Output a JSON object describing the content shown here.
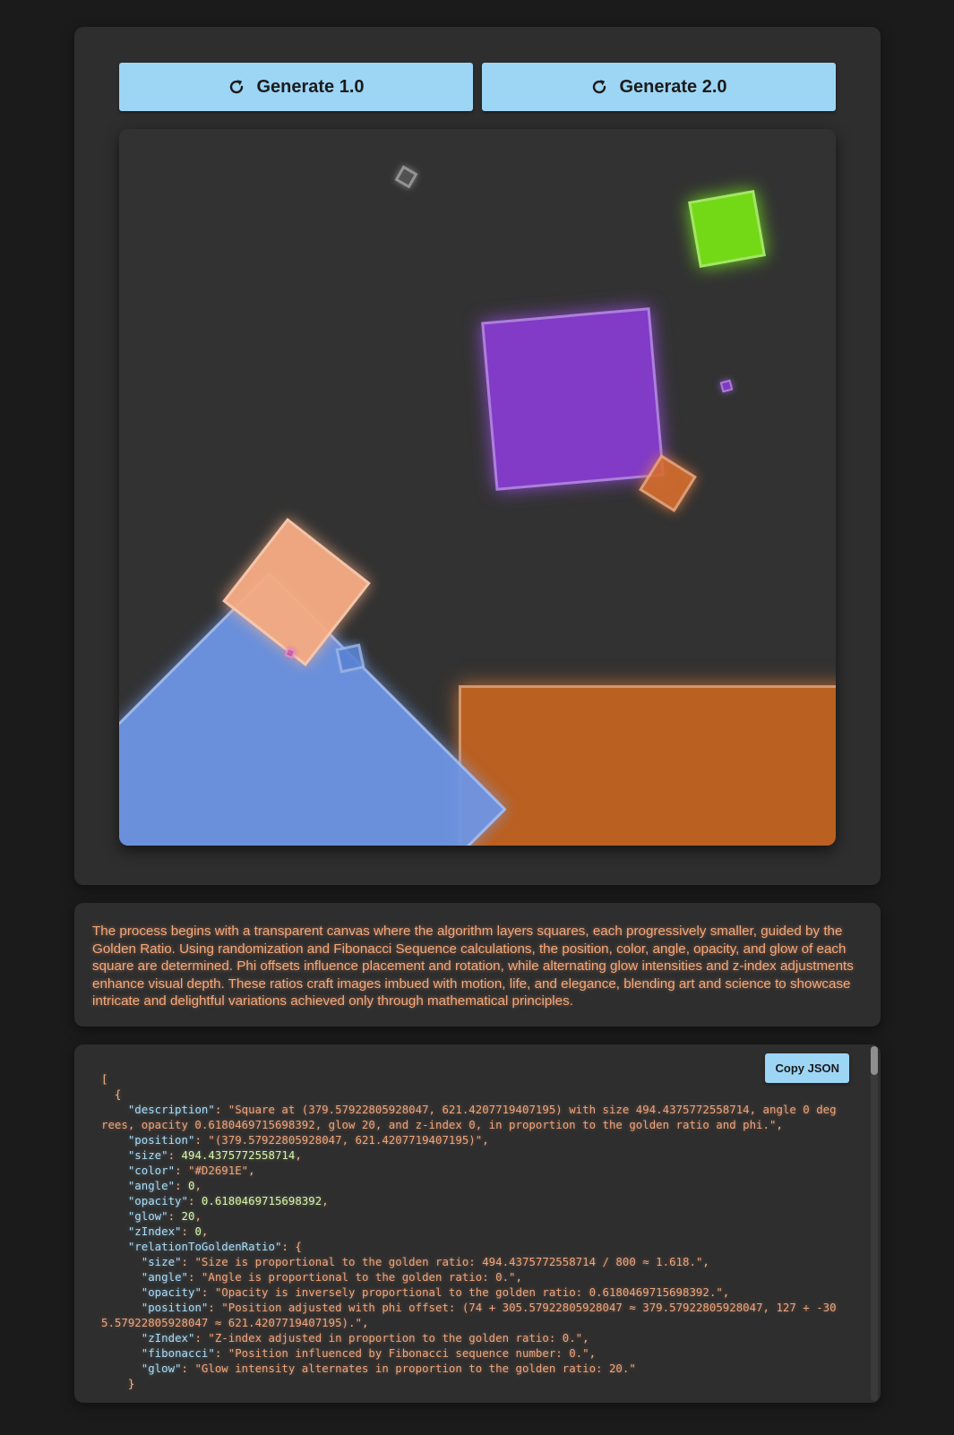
{
  "buttons": {
    "generate_1": "Generate 1.0",
    "generate_2": "Generate 2.0",
    "copy_json": "Copy JSON"
  },
  "icons": {
    "generate": "refresh-icon"
  },
  "colors": {
    "button_bg": "#9dd5f5",
    "text_accent": "#f7a778",
    "json_key": "#a8dcf8",
    "json_number": "#d7f3a8",
    "canvas_bg": "#323232",
    "page_bg": "#1b1b1b"
  },
  "description": "The process begins with a transparent canvas where the algorithm layers squares, each progressively smaller, guided by the Golden Ratio. Using randomization and Fibonacci Sequence calculations, the position, color, angle, opacity, and glow of each square are determined. Phi offsets influence placement and rotation, while alternating glow intensities and z-index adjustments enhance visual depth. These ratios craft images imbued with motion, life, and elegance, blending art and science to showcase intricate and delightful variations achieved only through mathematical principles.",
  "json_lines": {
    "open_bracket": "[",
    "open_brace": "{",
    "k_description": "\"description\"",
    "v_description": "\"Square at (379.57922805928047, 621.4207719407195) with size 494.4375772558714, angle 0 degrees, opacity 0.6180469715698392, glow 20, and z-index 0, in proportion to the golden ratio and phi.\"",
    "k_position": "\"position\"",
    "v_position": "\"(379.57922805928047, 621.4207719407195)\"",
    "k_size": "\"size\"",
    "v_size": "494.4375772558714",
    "k_color": "\"color\"",
    "v_color": "\"#D2691E\"",
    "k_angle": "\"angle\"",
    "v_angle": "0",
    "k_opacity": "\"opacity\"",
    "v_opacity": "0.6180469715698392",
    "k_glow": "\"glow\"",
    "v_glow": "20",
    "k_zindex": "\"zIndex\"",
    "v_zindex": "0",
    "k_relation": "\"relationToGoldenRatio\"",
    "r_k_size": "\"size\"",
    "r_v_size": "\"Size is proportional to the golden ratio: 494.4375772558714 / 800 ≈ 1.618.\"",
    "r_k_angle": "\"angle\"",
    "r_v_angle": "\"Angle is proportional to the golden ratio: 0.\"",
    "r_k_opacity": "\"opacity\"",
    "r_v_opacity": "\"Opacity is inversely proportional to the golden ratio: 0.6180469715698392.\"",
    "r_k_position": "\"position\"",
    "r_v_position": "\"Position adjusted with phi offset: (74 + 305.57922805928047 ≈ 379.57922805928047, 127 + -305.57922805928047 ≈ 621.4207719407195).\"",
    "r_k_zindex": "\"zIndex\"",
    "r_v_zindex": "\"Z-index adjusted in proportion to the golden ratio: 0.\"",
    "r_k_fibonacci": "\"fibonacci\"",
    "r_v_fibonacci": "\"Position influenced by Fibonacci sequence number: 0.\"",
    "r_k_glow": "\"glow\"",
    "r_v_glow": "\"Glow intensity alternates in proportion to the golden ratio: 20.\"",
    "close_brace": "}"
  }
}
